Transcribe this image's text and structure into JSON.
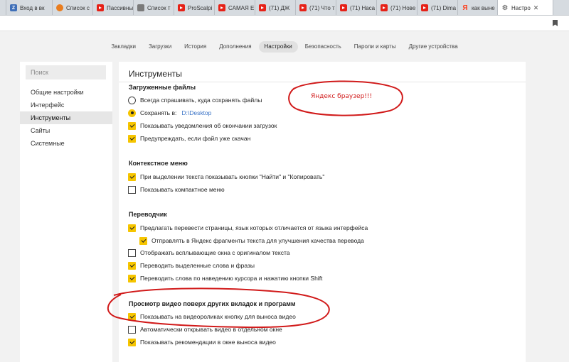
{
  "tabs": [
    {
      "label": "Вход в вк",
      "icon": "z-icon",
      "color": "#3f6fb8",
      "glyph": "Z"
    },
    {
      "label": "Список с",
      "icon": "list-icon",
      "color": "#e97d1f",
      "glyph": ""
    },
    {
      "label": "Пассивны",
      "icon": "youtube-icon",
      "color": "#e62117",
      "glyph": ""
    },
    {
      "label": "Список т",
      "icon": "tools-icon",
      "color": "#7a7a7a",
      "glyph": ""
    },
    {
      "label": "ProScalpi",
      "icon": "youtube-icon",
      "color": "#e62117",
      "glyph": ""
    },
    {
      "label": "САМАЯ Е",
      "icon": "youtube-icon",
      "color": "#e62117",
      "glyph": ""
    },
    {
      "label": "(71) ДЖ",
      "icon": "youtube-icon",
      "color": "#e62117",
      "glyph": ""
    },
    {
      "label": "(71) Что т",
      "icon": "youtube-icon",
      "color": "#e62117",
      "glyph": ""
    },
    {
      "label": "(71) Наса",
      "icon": "youtube-icon",
      "color": "#e62117",
      "glyph": ""
    },
    {
      "label": "(71) Нове",
      "icon": "youtube-icon",
      "color": "#e62117",
      "glyph": ""
    },
    {
      "label": "(71) Dima",
      "icon": "youtube-icon",
      "color": "#e62117",
      "glyph": ""
    },
    {
      "label": "как выне",
      "icon": "yandex-icon",
      "color": "#fc3f1d",
      "glyph": "Я"
    },
    {
      "label": "Настро",
      "icon": "gear-icon",
      "color": "#444444",
      "glyph": "⚙",
      "active": true
    }
  ],
  "nav": [
    {
      "label": "Закладки"
    },
    {
      "label": "Загрузки"
    },
    {
      "label": "История"
    },
    {
      "label": "Дополнения"
    },
    {
      "label": "Настройки",
      "active": true
    },
    {
      "label": "Безопасность"
    },
    {
      "label": "Пароли и карты"
    },
    {
      "label": "Другие устройства"
    }
  ],
  "sidebar": {
    "search_placeholder": "Поиск",
    "items": [
      {
        "label": "Общие настройки"
      },
      {
        "label": "Интерфейс"
      },
      {
        "label": "Инструменты",
        "active": true
      },
      {
        "label": "Сайты"
      },
      {
        "label": "Системные"
      }
    ]
  },
  "main": {
    "title": "Инструменты",
    "downloads": {
      "title": "Загруженные файлы",
      "ask_where": "Всегда спрашивать, куда сохранять файлы",
      "save_to": "Сохранять в:",
      "save_path": "D:\\Desktop",
      "notify": "Показывать уведомления об окончании загрузок",
      "warn": "Предупреждать, если файл уже скачан"
    },
    "context_menu": {
      "title": "Контекстное меню",
      "find_copy": "При выделении текста показывать кнопки \"Найти\" и \"Копировать\"",
      "compact": "Показывать компактное меню"
    },
    "translator": {
      "title": "Переводчик",
      "offer": "Предлагать перевести страницы, язык которых отличается от языка интерфейса",
      "send_fragments": "Отправлять в Яндекс фрагменты текста для улучшения качества перевода",
      "popup_original": "Отображать всплывающие окна с оригиналом текста",
      "translate_selected": "Переводить выделенные слова и фразы",
      "translate_hover": "Переводить слова по наведению курсора и нажатию кнопки Shift"
    },
    "video": {
      "title": "Просмотр видео поверх других вкладок и программ",
      "show_button": "Показывать на видеороликах кнопку для выноса видео",
      "auto_open": "Автоматически открывать видео в отдельном окне",
      "recommendations": "Показывать рекомендации в окне выноса видео"
    }
  },
  "annotation": {
    "text": "Яндекс браузер!!!",
    "color": "#d11a1a"
  }
}
